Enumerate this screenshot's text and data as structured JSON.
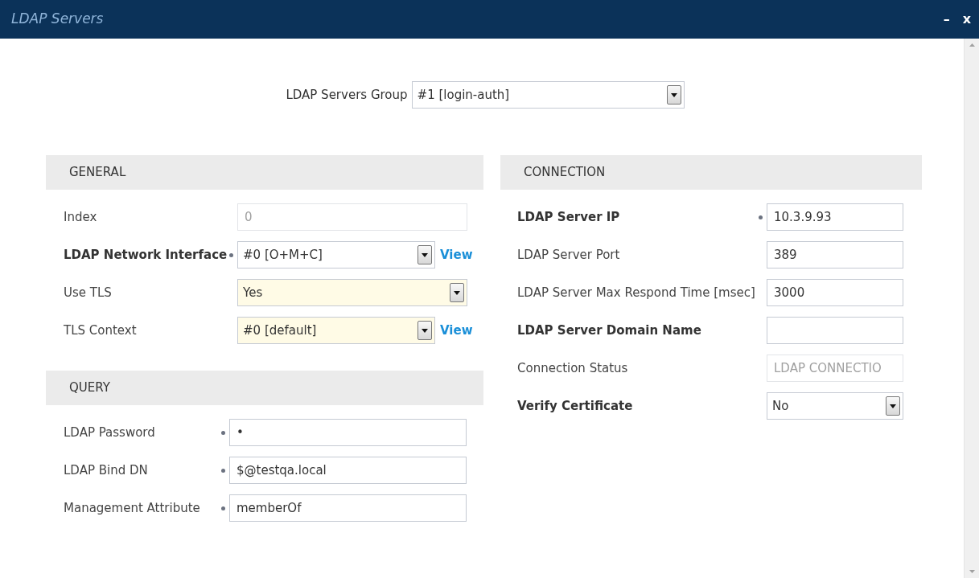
{
  "window": {
    "title": "LDAP Servers",
    "controls": [
      "–",
      "x"
    ]
  },
  "group_selector": {
    "label": "LDAP Servers Group",
    "value": "#1 [login-auth]"
  },
  "columns": [
    {
      "sections": [
        {
          "title": "GENERAL",
          "fields": [
            {
              "label": "Index",
              "kind": "readonly",
              "value": "0",
              "bold": false,
              "dot": false,
              "highlighted": false
            },
            {
              "label": "LDAP Network Interface",
              "kind": "select",
              "value": "#0 [O+M+C]",
              "bold": true,
              "dot": true,
              "highlighted": false,
              "link": "View"
            },
            {
              "label": "Use TLS",
              "kind": "select",
              "value": "Yes",
              "bold": false,
              "dot": false,
              "highlighted": true
            },
            {
              "label": "TLS Context",
              "kind": "select",
              "value": "#0 [default]",
              "bold": false,
              "dot": false,
              "highlighted": true,
              "link": "View"
            }
          ]
        },
        {
          "title": "QUERY",
          "fields": [
            {
              "label": "LDAP Password",
              "kind": "text",
              "value": "•",
              "bold": false,
              "dot": true,
              "highlighted": false
            },
            {
              "label": "LDAP Bind DN",
              "kind": "text",
              "value": "$@testqa.local",
              "bold": false,
              "dot": true,
              "highlighted": false
            },
            {
              "label": "Management Attribute",
              "kind": "text",
              "value": "memberOf",
              "bold": false,
              "dot": true,
              "highlighted": false
            }
          ]
        }
      ]
    },
    {
      "sections": [
        {
          "title": "CONNECTION",
          "fields": [
            {
              "label": "LDAP Server IP",
              "kind": "text",
              "value": "10.3.9.93",
              "bold": true,
              "dot": true,
              "highlighted": false
            },
            {
              "label": "LDAP Server Port",
              "kind": "text",
              "value": "389",
              "bold": false,
              "dot": false,
              "highlighted": false
            },
            {
              "label": "LDAP Server Max Respond Time [msec]",
              "kind": "text",
              "value": "3000",
              "bold": false,
              "dot": false,
              "highlighted": false
            },
            {
              "label": "LDAP Server Domain Name",
              "kind": "text",
              "bold": true,
              "dot": false,
              "highlighted": false
            },
            {
              "label": "Connection Status",
              "kind": "readonly",
              "value": "LDAP CONNECTIO",
              "bold": false,
              "dot": false,
              "highlighted": false
            },
            {
              "label": "Verify Certificate",
              "kind": "select",
              "value": "No",
              "bold": true,
              "dot": false,
              "highlighted": false
            }
          ]
        }
      ]
    }
  ]
}
